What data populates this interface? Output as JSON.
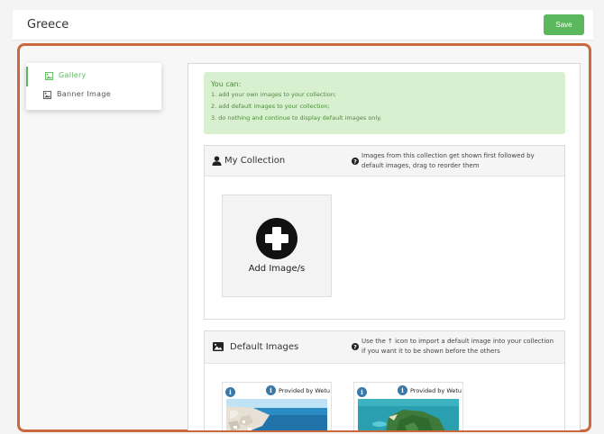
{
  "header": {
    "title": "Greece",
    "save_label": "Save"
  },
  "sidebar": {
    "items": [
      {
        "label": "Gallery",
        "icon": "image-icon",
        "active": true
      },
      {
        "label": "Banner Image",
        "icon": "image-icon",
        "active": false
      }
    ]
  },
  "info": {
    "title": "You can:",
    "lines": [
      "1. add your own images to your collection;",
      "2. add default images to your collection;",
      "3. do nothing and continue to display default images only."
    ]
  },
  "my_collection": {
    "title": "My Collection",
    "hint": "Images from this collection get shown first followed by default images, drag to reorder them",
    "add_label": "Add Image/s"
  },
  "default_images": {
    "title": "Default Images",
    "hint": "Use the ↑ icon to import a default image into your collection if you want it to be shown before the others",
    "cards": [
      {
        "provider": "Provided by Wetu"
      },
      {
        "provider": "Provided by Wetu"
      }
    ]
  },
  "colors": {
    "accent": "#5cb85c",
    "highlight": "#c9683d",
    "info_bg": "#d9f0d0",
    "badge": "#3a78a8"
  }
}
